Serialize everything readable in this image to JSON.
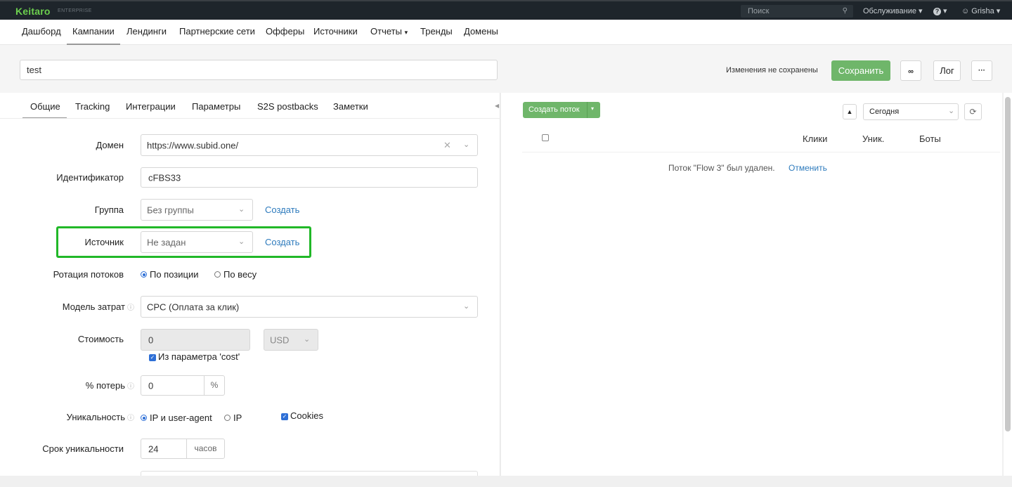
{
  "topbar": {
    "brand": "Keitaro",
    "brand_sub": "ENTERPRISE",
    "search_placeholder": "Поиск",
    "service_menu": "Обслуживание",
    "help_menu": "?",
    "user_menu": "Grisha"
  },
  "nav": {
    "items": [
      "Дашборд",
      "Кампании",
      "Лендинги",
      "Партнерские сети",
      "Офферы",
      "Источники",
      "Отчеты",
      "Тренды",
      "Домены"
    ],
    "active": "Кампании"
  },
  "campaign": {
    "name": "test",
    "unsaved_text": "Изменения не сохранены",
    "save_label": "Сохранить",
    "log_label": "Лог",
    "more_label": "···"
  },
  "tabs": [
    "Общие",
    "Tracking",
    "Интеграции",
    "Параметры",
    "S2S postbacks",
    "Заметки"
  ],
  "form": {
    "domain_label": "Домен",
    "domain_value": "https://www.subid.one/",
    "identifier_label": "Идентификатор",
    "identifier_value": "cFBS33",
    "group_label": "Группа",
    "group_value": "Без группы",
    "group_create": "Создать",
    "source_label": "Источник",
    "source_value": "Не задан",
    "source_create": "Создать",
    "rotation_label": "Ротация потоков",
    "rotation_options": [
      "По позиции",
      "По весу"
    ],
    "rotation_selected": "По позиции",
    "cost_model_label": "Модель затрат",
    "cost_model_value": "CPC (Оплата за клик)",
    "cost_label": "Стоимость",
    "cost_value": "0",
    "currency_value": "USD",
    "cost_from_param": "Из параметра 'cost'",
    "loss_label": "% потерь",
    "loss_value": "0",
    "loss_unit": "%",
    "uniqueness_label": "Уникальность",
    "uniqueness_options": [
      "IP и user-agent",
      "IP"
    ],
    "uniqueness_selected": "IP и user-agent",
    "cookies_label": "Cookies",
    "uniq_term_label": "Срок уникальности",
    "uniq_term_value": "24",
    "uniq_term_unit": "часов"
  },
  "flows": {
    "create_label": "Создать поток",
    "period_value": "Сегодня",
    "columns": [
      "Клики",
      "Уник.",
      "Боты"
    ],
    "deleted_msg": "Поток \"Flow 3\" был удален.",
    "undo_label": "Отменить"
  }
}
